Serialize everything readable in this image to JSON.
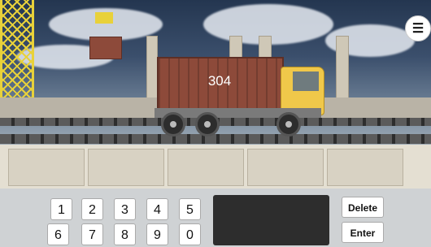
{
  "scene": {
    "container_number": "304",
    "menu_icon": "list-menu-icon"
  },
  "keypad": {
    "row1": [
      "1",
      "2",
      "3",
      "4",
      "5"
    ],
    "row2": [
      "6",
      "7",
      "8",
      "9",
      "0"
    ],
    "delete_label": "Delete",
    "enter_label": "Enter",
    "display_value": ""
  }
}
